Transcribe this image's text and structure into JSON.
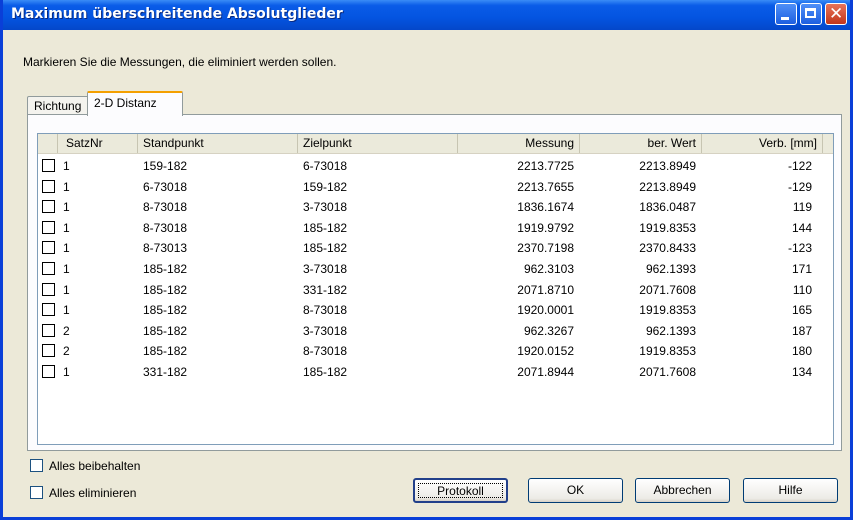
{
  "window": {
    "title": "Maximum überschreitende Absolutglieder"
  },
  "instruction": "Markieren Sie die Messungen, die eliminiert werden sollen.",
  "tabs": [
    {
      "label": "Richtung"
    },
    {
      "label": "2-D Distanz"
    }
  ],
  "table": {
    "columns": [
      "SatzNr",
      "Standpunkt",
      "Zielpunkt",
      "Messung",
      "ber. Wert",
      "Verb. [mm]"
    ],
    "rows": [
      {
        "satznr": "1",
        "standpunkt": "159-182",
        "zielpunkt": "6-73018",
        "messung": "2213.7725",
        "ber_wert": "2213.8949",
        "verb": "-122"
      },
      {
        "satznr": "1",
        "standpunkt": "6-73018",
        "zielpunkt": "159-182",
        "messung": "2213.7655",
        "ber_wert": "2213.8949",
        "verb": "-129"
      },
      {
        "satznr": "1",
        "standpunkt": "8-73018",
        "zielpunkt": "3-73018",
        "messung": "1836.1674",
        "ber_wert": "1836.0487",
        "verb": "119"
      },
      {
        "satznr": "1",
        "standpunkt": "8-73018",
        "zielpunkt": "185-182",
        "messung": "1919.9792",
        "ber_wert": "1919.8353",
        "verb": "144"
      },
      {
        "satznr": "1",
        "standpunkt": "8-73013",
        "zielpunkt": "185-182",
        "messung": "2370.7198",
        "ber_wert": "2370.8433",
        "verb": "-123"
      },
      {
        "satznr": "1",
        "standpunkt": "185-182",
        "zielpunkt": "3-73018",
        "messung": "962.3103",
        "ber_wert": "962.1393",
        "verb": "171"
      },
      {
        "satznr": "1",
        "standpunkt": "185-182",
        "zielpunkt": "331-182",
        "messung": "2071.8710",
        "ber_wert": "2071.7608",
        "verb": "110"
      },
      {
        "satznr": "1",
        "standpunkt": "185-182",
        "zielpunkt": "8-73018",
        "messung": "1920.0001",
        "ber_wert": "1919.8353",
        "verb": "165"
      },
      {
        "satznr": "2",
        "standpunkt": "185-182",
        "zielpunkt": "3-73018",
        "messung": "962.3267",
        "ber_wert": "962.1393",
        "verb": "187"
      },
      {
        "satznr": "2",
        "standpunkt": "185-182",
        "zielpunkt": "8-73018",
        "messung": "1920.0152",
        "ber_wert": "1919.8353",
        "verb": "180"
      },
      {
        "satznr": "1",
        "standpunkt": "331-182",
        "zielpunkt": "185-182",
        "messung": "2071.8944",
        "ber_wert": "2071.7608",
        "verb": "134"
      }
    ]
  },
  "options": {
    "keep_all": "Alles beibehalten",
    "eliminate_all": "Alles eliminieren"
  },
  "buttons": {
    "protokoll": "Protokoll",
    "ok": "OK",
    "abbrechen": "Abbrechen",
    "hilfe": "Hilfe"
  },
  "colors": {
    "titlebar": "#0454e0",
    "dialog_bg": "#ece9d8",
    "active_tab_accent": "#f4a000",
    "close_button": "#c2361a"
  }
}
